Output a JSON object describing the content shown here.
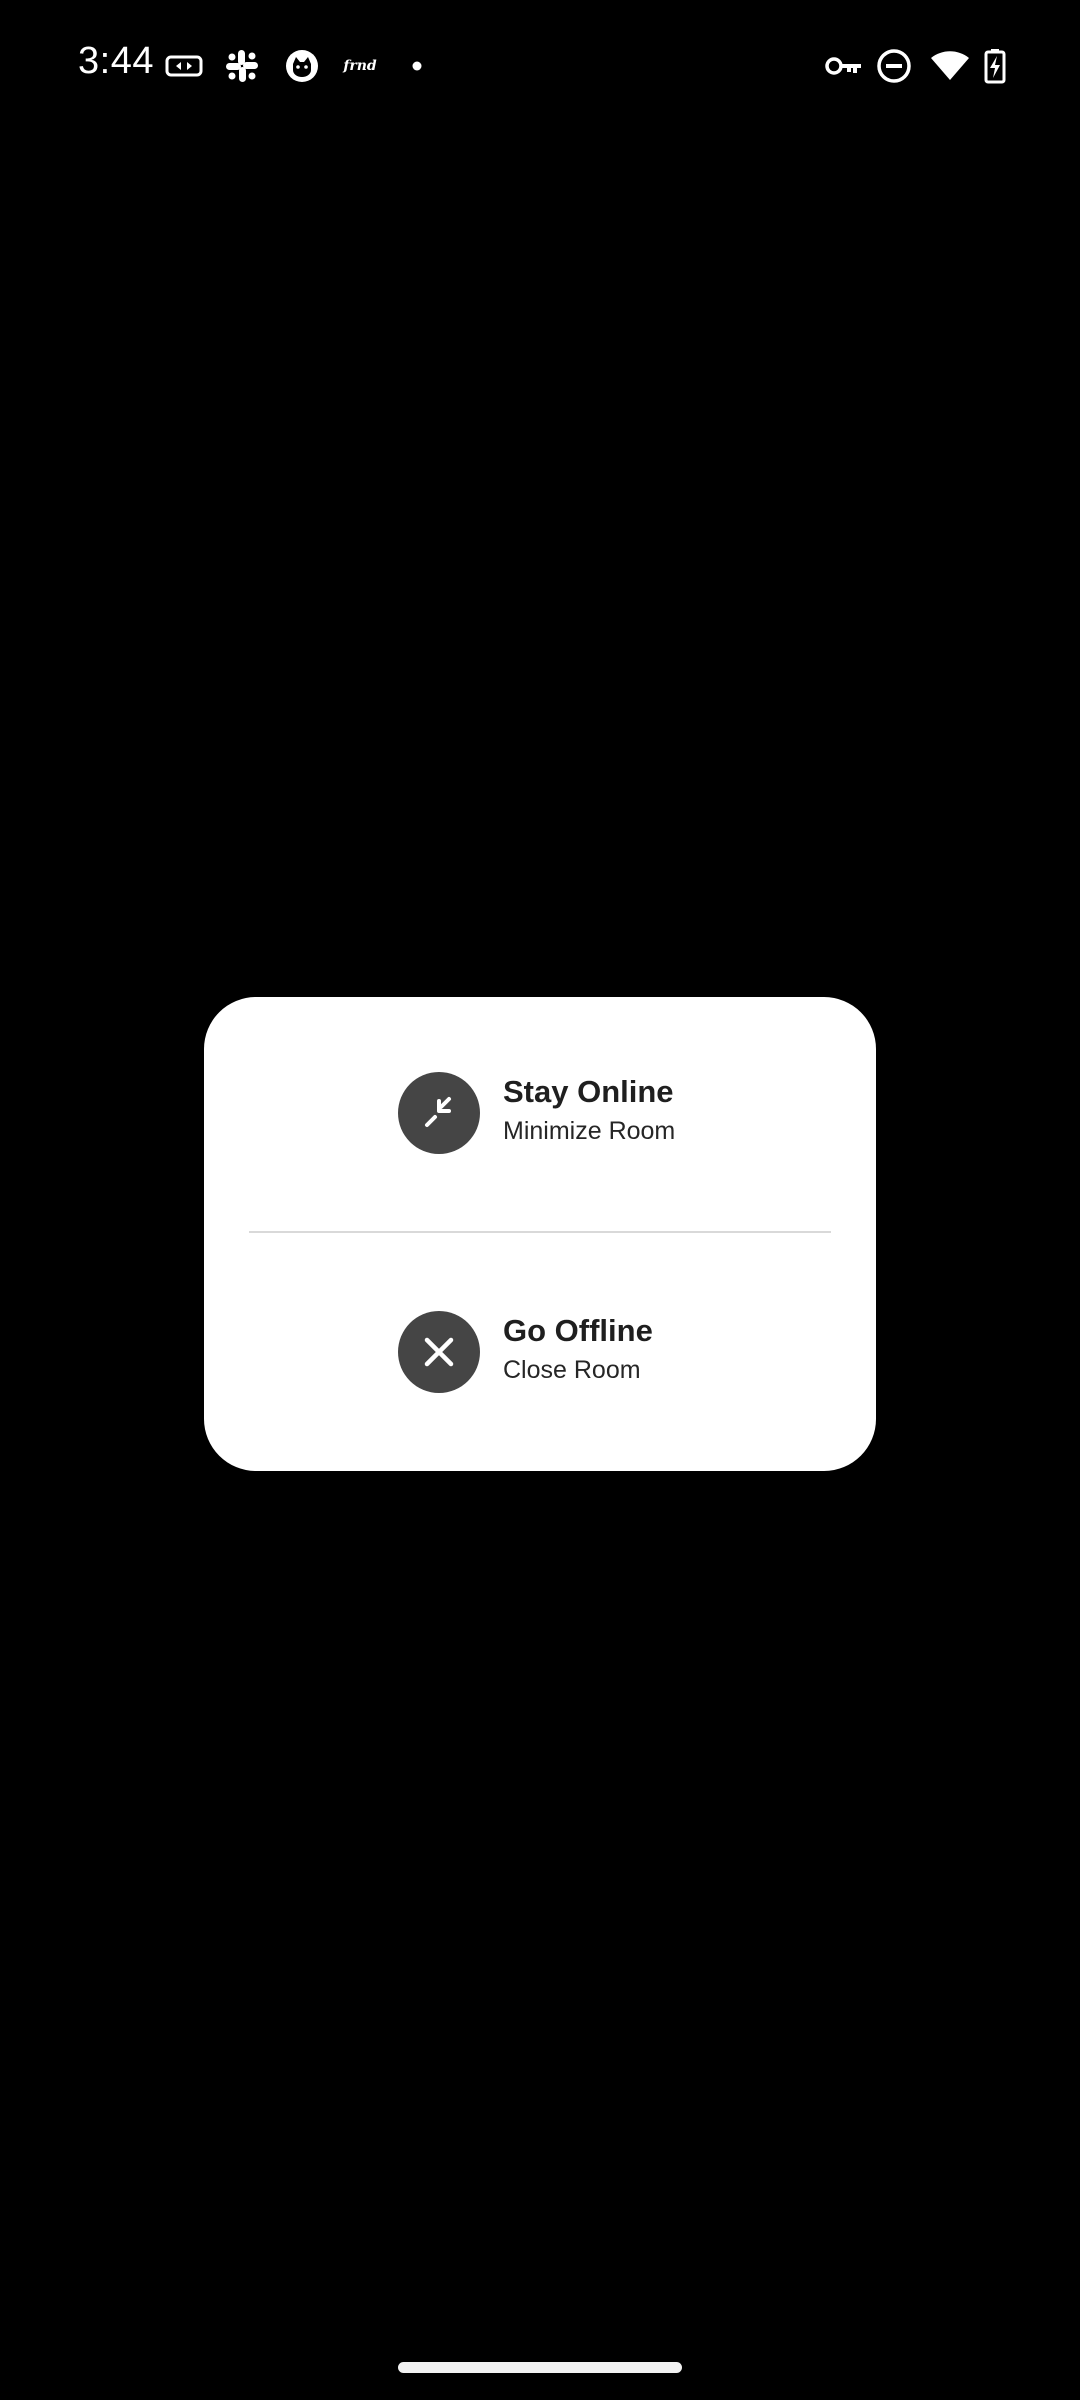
{
  "status_bar": {
    "time": "3:44",
    "left_icons": [
      "meet-icon",
      "slack-icon",
      "cat-app-icon",
      "frnd-icon",
      "notification-dot-icon"
    ],
    "frnd_text": "frnd",
    "right_icons": [
      "vpn-key-icon",
      "do-not-disturb-icon",
      "wifi-icon",
      "battery-charging-icon"
    ]
  },
  "dialog": {
    "stay_online": {
      "title": "Stay Online",
      "subtitle": "Minimize Room",
      "icon": "minimize-icon"
    },
    "go_offline": {
      "title": "Go Offline",
      "subtitle": "Close Room",
      "icon": "close-icon"
    }
  },
  "colors": {
    "background": "#000000",
    "dialog": "#ffffff",
    "icon_circle": "#454545",
    "title": "#1f1f1f"
  }
}
